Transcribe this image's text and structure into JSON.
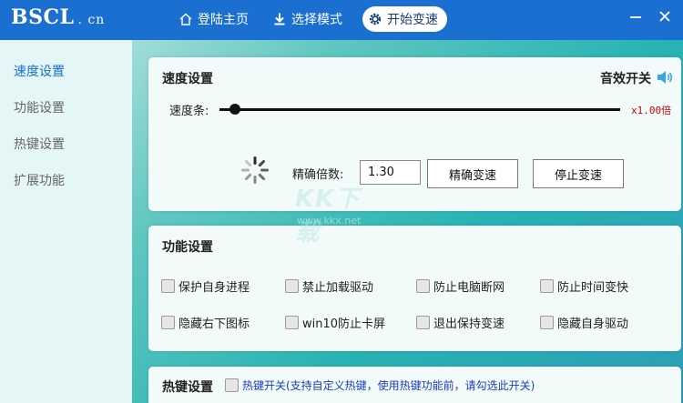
{
  "header": {
    "logo_main": "BSCL",
    "logo_domain": ". cn",
    "nav": [
      {
        "label": "登陆主页",
        "icon": "home-icon"
      },
      {
        "label": "选择模式",
        "icon": "download-icon"
      },
      {
        "label": "开始变速",
        "icon": "gear-icon",
        "active": true
      }
    ]
  },
  "sidebar": {
    "items": [
      {
        "label": "速度设置",
        "active": true
      },
      {
        "label": "功能设置"
      },
      {
        "label": "热键设置"
      },
      {
        "label": "扩展功能"
      }
    ]
  },
  "speed": {
    "title": "速度设置",
    "sound_label": "音效开关",
    "slider_label": "速度条:",
    "multiplier": "x1.00倍",
    "precise_label": "精确倍数:",
    "precise_value": "1.30",
    "precise_button": "精确变速",
    "stop_button": "停止变速"
  },
  "features": {
    "title": "功能设置",
    "options": [
      "保护自身进程",
      "禁止加载驱动",
      "防止电脑断网",
      "防止时间变快",
      "隐藏右下图标",
      "win10防止卡屏",
      "退出保持变速",
      "隐藏自身驱动"
    ]
  },
  "hotkey": {
    "title": "热键设置",
    "toggle_label": "热键开关(支持自定义热键，使用热键功能前，请勾选此开关)"
  },
  "watermark": {
    "text": "KK下载",
    "url": "www.kkx.net"
  },
  "colors": {
    "header": "#1a6fd0",
    "accent": "#1a6fd0",
    "multiplier": "#d00000",
    "hotkey_text": "#1a3ebc"
  }
}
